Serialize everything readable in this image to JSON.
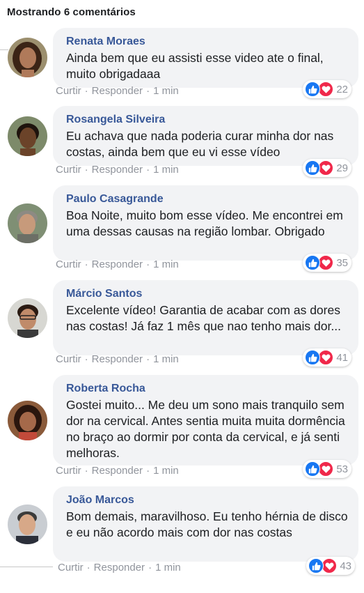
{
  "header": {
    "title": "Mostrando 6 comentários"
  },
  "labels": {
    "like": "Curtir",
    "reply": "Responder",
    "separator": "·"
  },
  "colors": {
    "author": "#385898",
    "bubble": "#f2f3f5",
    "like": "#1877f2",
    "love": "#f0284a",
    "muted": "#90949c"
  },
  "comments": [
    {
      "author": "Renata Moraes",
      "text": "Ainda bem que eu assisti esse video ate o final, muito obrigadaaa",
      "time": "1 min",
      "count": "22",
      "icons": [
        "thumbs-up-icon",
        "heart-icon"
      ]
    },
    {
      "author": "Rosangela Silveira",
      "text": "Eu achava que nada poderia curar minha dor nas costas, ainda bem que eu vi esse vídeo",
      "time": "1 min",
      "count": "29",
      "icons": [
        "thumbs-up-icon",
        "heart-icon"
      ]
    },
    {
      "author": "Paulo Casagrande",
      "text": "Boa Noite, muito bom esse vídeo. Me encontrei em uma dessas causas na região lombar. Obrigado",
      "time": "1 min",
      "count": "35",
      "icons": [
        "thumbs-up-icon",
        "heart-icon"
      ]
    },
    {
      "author": "Márcio Santos",
      "text": "Excelente vídeo! Garantia de acabar com as dores nas costas! Já faz 1 mês que nao tenho mais dor...",
      "time": "1 min",
      "count": "41",
      "icons": [
        "thumbs-up-icon",
        "heart-icon"
      ]
    },
    {
      "author": "Roberta Rocha",
      "text": "Gostei muito... Me deu um sono mais tranquilo sem dor na cervical. Antes sentia muita muita dormência no braço ao dormir por conta da cervical, e já senti melhoras.",
      "time": "1 min",
      "count": "53",
      "icons": [
        "thumbs-up-icon",
        "heart-icon"
      ]
    },
    {
      "author": "João Marcos",
      "text": "Bom demais, maravilhoso. Eu tenho hérnia de disco e eu não acordo mais com dor nas costas",
      "time": "1 min",
      "count": "43",
      "icons": [
        "thumbs-up-icon",
        "heart-icon"
      ]
    }
  ]
}
